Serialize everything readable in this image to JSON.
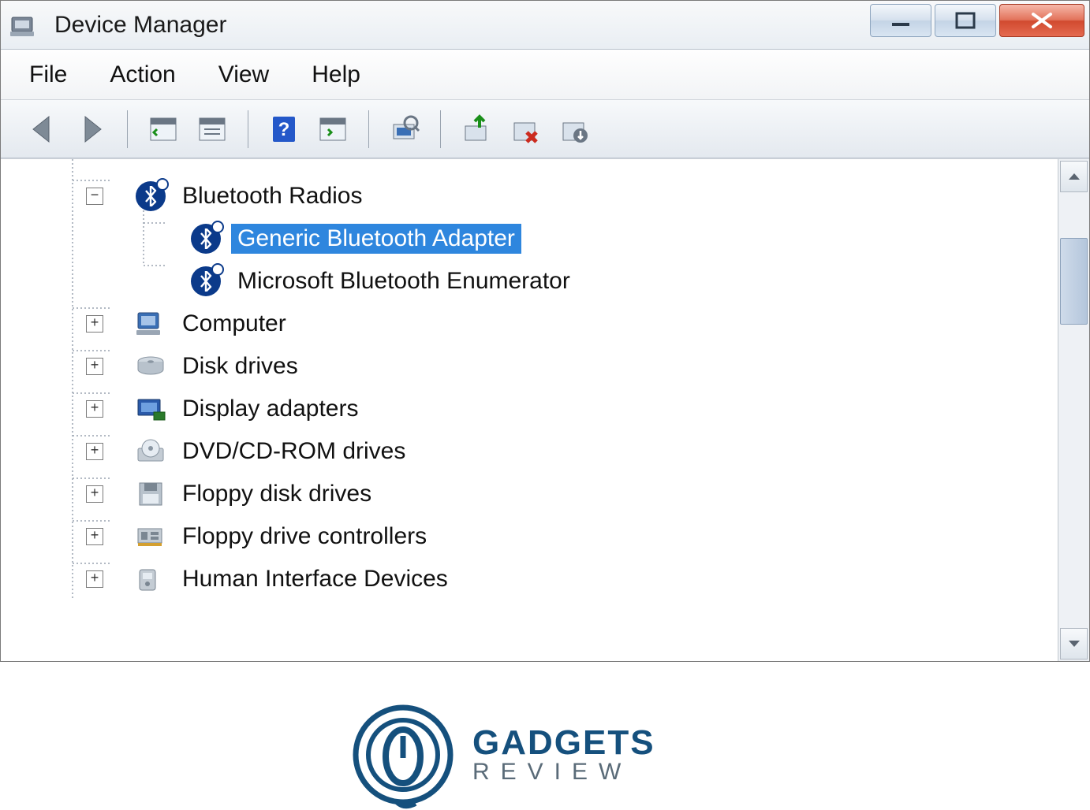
{
  "window": {
    "title": "Device Manager"
  },
  "menu": {
    "items": [
      "File",
      "Action",
      "View",
      "Help"
    ]
  },
  "toolbar": {
    "buttons": [
      "back",
      "forward",
      "sep",
      "show-hidden",
      "properties-pane",
      "sep",
      "help",
      "console-tree",
      "sep",
      "scan-hardware",
      "sep",
      "update-driver",
      "uninstall",
      "disable"
    ]
  },
  "tree": {
    "nodes": [
      {
        "id": "bluetooth-radios",
        "label": "Bluetooth Radios",
        "icon": "bluetooth",
        "expanded": true,
        "depth": 0,
        "children": [
          {
            "id": "generic-bt-adapter",
            "label": "Generic Bluetooth Adapter",
            "icon": "bluetooth",
            "selected": true,
            "depth": 1
          },
          {
            "id": "ms-bt-enumerator",
            "label": "Microsoft Bluetooth Enumerator",
            "icon": "bluetooth",
            "selected": false,
            "depth": 1
          }
        ]
      },
      {
        "id": "computer",
        "label": "Computer",
        "icon": "computer",
        "expanded": false,
        "depth": 0
      },
      {
        "id": "disk-drives",
        "label": "Disk drives",
        "icon": "disk",
        "expanded": false,
        "depth": 0
      },
      {
        "id": "display-adapters",
        "label": "Display adapters",
        "icon": "display",
        "expanded": false,
        "depth": 0
      },
      {
        "id": "dvd-cd-rom",
        "label": "DVD/CD-ROM drives",
        "icon": "optical",
        "expanded": false,
        "depth": 0
      },
      {
        "id": "floppy-disk-drives",
        "label": "Floppy disk drives",
        "icon": "floppy",
        "expanded": false,
        "depth": 0
      },
      {
        "id": "floppy-drive-controllers",
        "label": "Floppy drive controllers",
        "icon": "floppy-ctrl",
        "expanded": false,
        "depth": 0
      },
      {
        "id": "hid",
        "label": "Human Interface Devices",
        "icon": "hid",
        "expanded": false,
        "depth": 0
      }
    ]
  },
  "watermark": {
    "line1": "GADGETS",
    "line2": "REVIEW"
  },
  "expander": {
    "plus": "+",
    "minus": "−"
  }
}
